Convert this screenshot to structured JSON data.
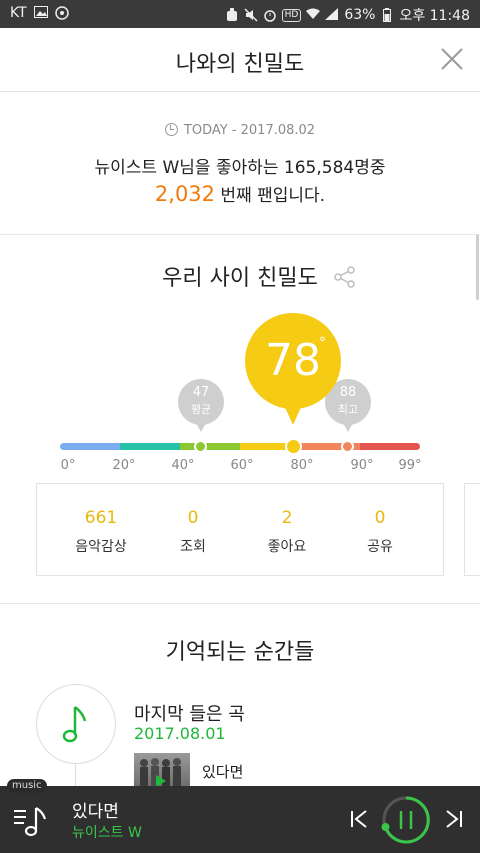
{
  "status_bar": {
    "carrier": "KT",
    "battery": "63%",
    "time": "오후 11:48",
    "hd_badge": "HD",
    "left_icons": [
      "image-icon",
      "music-icon"
    ],
    "right_icons": [
      "alarm-icon",
      "mute-icon",
      "wifi-icon",
      "signal-icon",
      "battery-icon"
    ]
  },
  "header": {
    "title": "나와의 친밀도",
    "close_icon": "close-icon"
  },
  "today": {
    "label": "TODAY - 2017.08.02",
    "rank_text": "뉴이스트 W님을 좋아하는 165,584명중",
    "rank_number": "2,032",
    "rank_suffix": " 번째 팬입니다."
  },
  "intimacy": {
    "title": "우리 사이 친밀도",
    "value": "78",
    "degree": "°",
    "average": {
      "value": "47",
      "label": "평균"
    },
    "max": {
      "value": "88",
      "label": "최고"
    },
    "ticks": [
      "0°",
      "20°",
      "40°",
      "60°",
      "80°",
      "90°",
      "99°"
    ],
    "gauge_colors": [
      "#7aaef0",
      "#26c1a8",
      "#8cc832",
      "#f5cb14",
      "#f2855c",
      "#e4554f"
    ]
  },
  "stats": [
    {
      "value": "661",
      "label": "음악감상"
    },
    {
      "value": "0",
      "label": "조회"
    },
    {
      "value": "2",
      "label": "좋아요"
    },
    {
      "value": "0",
      "label": "공유"
    }
  ],
  "memories": {
    "title": "기억되는 순간들",
    "item_label": "마지막 들은 곡",
    "item_date": "2017.08.01",
    "song": "있다면"
  },
  "player": {
    "tag": "music",
    "title": "있다면",
    "artist": "뉴이스트 W"
  },
  "colors": {
    "accent_yellow": "#f5cb14",
    "accent_green": "#1fb839",
    "rank_orange": "#f07a0c"
  }
}
